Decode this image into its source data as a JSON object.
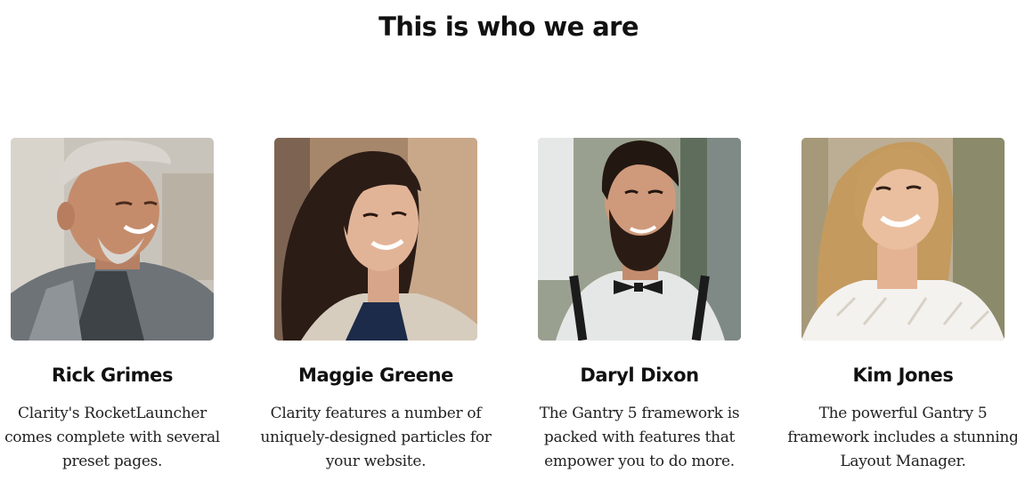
{
  "section": {
    "title": "This is who we are"
  },
  "members": [
    {
      "name": "Rick Grimes",
      "bio": "Clarity's RocketLauncher comes complete with several preset pages.",
      "photo_icon": "person-photo-icon"
    },
    {
      "name": "Maggie Greene",
      "bio": "Clarity features a number of uniquely-designed particles for your website.",
      "photo_icon": "person-photo-icon"
    },
    {
      "name": "Daryl Dixon",
      "bio": "The Gantry 5 framework is packed with features that empower you to do more.",
      "photo_icon": "person-photo-icon"
    },
    {
      "name": "Kim Jones",
      "bio": "The powerful Gantry 5 framework includes a stunning Layout Manager.",
      "photo_icon": "person-photo-icon"
    }
  ]
}
